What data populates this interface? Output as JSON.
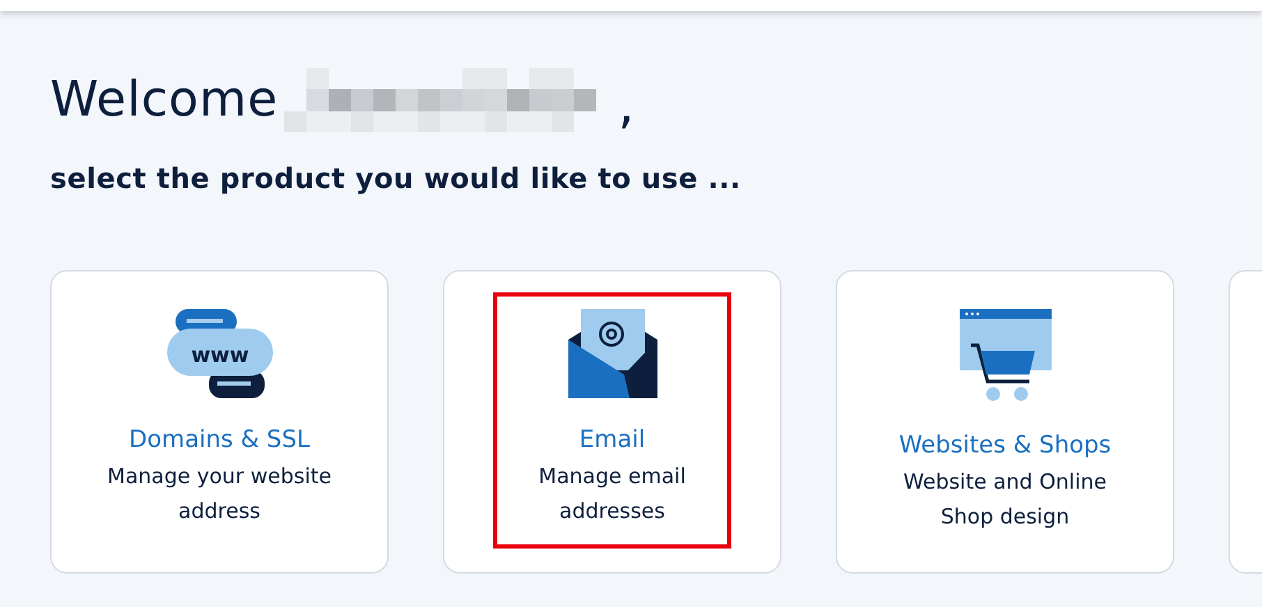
{
  "greeting": {
    "text": "Welcome",
    "name_redacted": true,
    "suffix": ","
  },
  "subtitle": "select the product you would like to use ...",
  "products": [
    {
      "kind": "domains",
      "icon_text": "www",
      "title": "Domains & SSL",
      "description": "Manage your website address",
      "highlighted": false
    },
    {
      "kind": "email",
      "title": "Email",
      "description": "Manage email addresses",
      "highlighted": true
    },
    {
      "kind": "websites",
      "title": "Websites & Shops",
      "description": "Website and Online Shop design",
      "highlighted": false
    },
    {
      "kind": "blank"
    }
  ]
}
